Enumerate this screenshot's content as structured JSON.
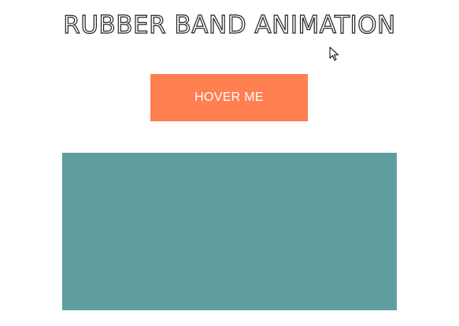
{
  "header": {
    "title": "RUBBER BAND ANIMATION"
  },
  "hover_button": {
    "label": "HOVER ME"
  },
  "colors": {
    "button": "#ff7f50",
    "box": "#5f9ea0",
    "background": "#ffffff",
    "title_stroke": "#222222"
  },
  "icons": {
    "cursor": "mouse-pointer-icon"
  }
}
